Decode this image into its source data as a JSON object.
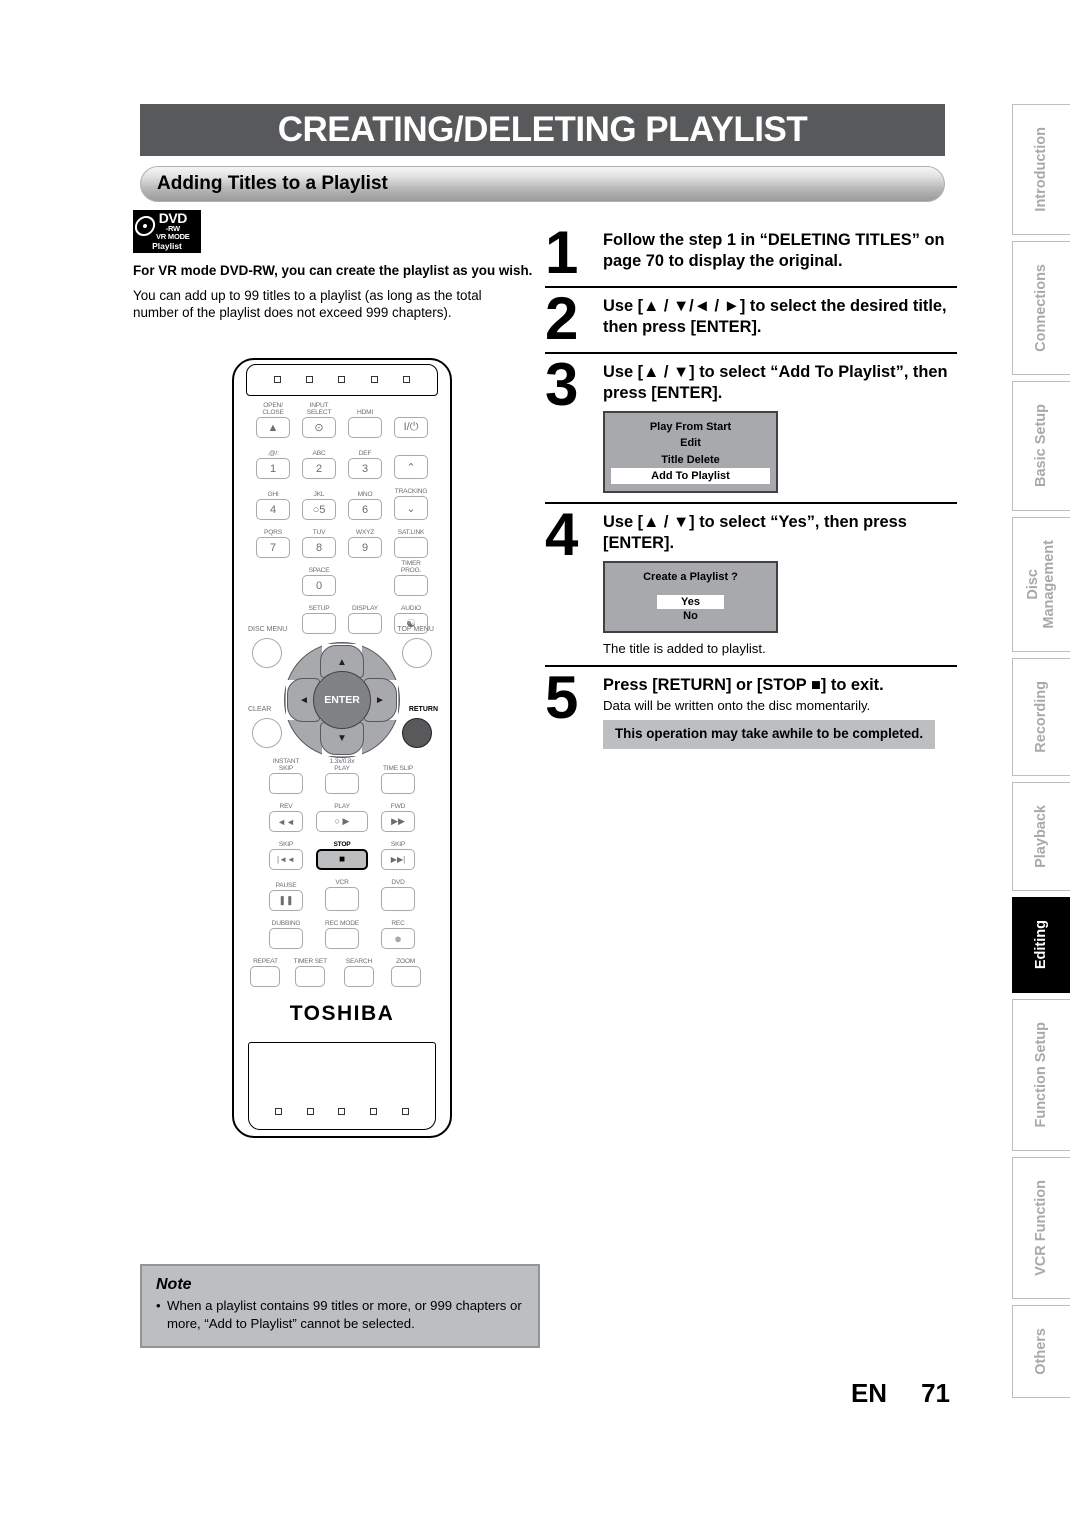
{
  "header": {
    "title": "CREATING/DELETING PLAYLIST",
    "subtitle": "Adding Titles to a Playlist"
  },
  "disc_badge": {
    "brand": "DVD",
    "format": "-RW",
    "mode": "VR MODE",
    "caption": "Playlist"
  },
  "intro": {
    "bold": "For VR mode DVD-RW, you can create the playlist as you wish.",
    "normal": "You can add up to 99 titles to a playlist (as long as the total number of the playlist does not exceed 999 chapters)."
  },
  "steps": [
    {
      "number": "1",
      "title": "Follow the step 1 in “DELETING TITLES” on page 70 to display the original."
    },
    {
      "number": "2",
      "title": "Use [▲ / ▼/◄ / ►] to select the desired title, then press [ENTER]."
    },
    {
      "number": "3",
      "title": "Use [▲ / ▼] to select “Add To Playlist”, then press [ENTER].",
      "osd_menu": {
        "items": [
          "Play From Start",
          "Edit",
          "Title Delete",
          "Add To Playlist"
        ],
        "selected": "Add To Playlist"
      }
    },
    {
      "number": "4",
      "title": "Use [▲ / ▼] to select “Yes”, then press [ENTER].",
      "osd_dialog": {
        "question": "Create a Playlist ?",
        "options": [
          "Yes",
          "No"
        ],
        "selected": "Yes"
      },
      "after_text": "The title is added to playlist."
    },
    {
      "number": "5",
      "title": "Press [RETURN] or [STOP ■] to exit.",
      "subtitle": "Data will be written onto the disc momentarily.",
      "highlight": "This operation may take awhile to be completed."
    }
  ],
  "note": {
    "title": "Note",
    "items": [
      "When a playlist contains 99 titles or more, or 999 chapters or more, “Add to Playlist” cannot be selected."
    ]
  },
  "footer": {
    "language": "EN",
    "page": "71"
  },
  "side_tabs": [
    {
      "label": "Introduction",
      "active": false
    },
    {
      "label": "Connections",
      "active": false
    },
    {
      "label": "Basic Setup",
      "active": false
    },
    {
      "label": "Disc\nManagement",
      "active": false
    },
    {
      "label": "Recording",
      "active": false
    },
    {
      "label": "Playback",
      "active": false
    },
    {
      "label": "Editing",
      "active": true
    },
    {
      "label": "Function Setup",
      "active": false
    },
    {
      "label": "VCR Function",
      "active": false
    },
    {
      "label": "Others",
      "active": false
    }
  ],
  "remote": {
    "brand": "TOSHIBA",
    "rows": [
      [
        {
          "label": "OPEN/\nCLOSE",
          "glyph": "▲",
          "shape": "rect"
        },
        {
          "label": "INPUT\nSELECT",
          "glyph": "⊙",
          "shape": "rect"
        },
        {
          "label": "HDMI",
          "glyph": "",
          "shape": "rect"
        },
        {
          "label": "",
          "glyph": "I/⏻",
          "shape": "rect"
        }
      ],
      [
        {
          "label": ".@/:",
          "glyph": "1",
          "shape": "rect"
        },
        {
          "label": "ABC",
          "glyph": "2",
          "shape": "rect"
        },
        {
          "label": "DEF",
          "glyph": "3",
          "shape": "rect"
        },
        {
          "label": "",
          "glyph": "⌃",
          "shape": "rect"
        }
      ],
      [
        {
          "label": "GHI",
          "glyph": "4",
          "shape": "rect"
        },
        {
          "label": "JKL",
          "glyph": "○5",
          "shape": "rect"
        },
        {
          "label": "MNO",
          "glyph": "6",
          "shape": "rect"
        },
        {
          "label": "TRACKING",
          "glyph": "⌄",
          "shape": "rect"
        }
      ],
      [
        {
          "label": "PQRS",
          "glyph": "7",
          "shape": "rect"
        },
        {
          "label": "TUV",
          "glyph": "8",
          "shape": "rect"
        },
        {
          "label": "WXYZ",
          "glyph": "9",
          "shape": "rect"
        },
        {
          "label": "SAT.LINK",
          "glyph": "",
          "shape": "rect"
        }
      ],
      [
        {
          "label": "",
          "glyph": "",
          "shape": "none"
        },
        {
          "label": "SPACE",
          "glyph": "0",
          "shape": "rect"
        },
        {
          "label": "",
          "glyph": "",
          "shape": "none"
        },
        {
          "label": "TIMER\nPROG.",
          "glyph": "",
          "shape": "rect"
        }
      ],
      [
        {
          "label": "",
          "glyph": "",
          "shape": "none"
        },
        {
          "label": "SETUP",
          "glyph": "",
          "shape": "rect"
        },
        {
          "label": "DISPLAY",
          "glyph": "",
          "shape": "rect"
        },
        {
          "label": "AUDIO",
          "glyph": "☯",
          "shape": "rect"
        }
      ]
    ],
    "nav": {
      "up": "▲",
      "down": "▼",
      "left": "◄",
      "right": "►",
      "enter": "ENTER",
      "disc_menu": "DISC MENU",
      "top_menu": "TOP MENU",
      "clear": "CLEAR",
      "return": "RETURN"
    },
    "transport_rows": [
      [
        {
          "label": "INSTANT\nSKIP",
          "glyph": ""
        },
        {
          "label": "1.3x/0.8x\nPLAY",
          "glyph": ""
        },
        {
          "label": "TIME SLIP",
          "glyph": ""
        }
      ],
      [
        {
          "label": "REV",
          "glyph": "◄◄"
        },
        {
          "label": "PLAY",
          "glyph": "○  ▶"
        },
        {
          "label": "FWD",
          "glyph": "▶▶"
        }
      ],
      [
        {
          "label": "SKIP",
          "glyph": "|◄◄"
        },
        {
          "label": "STOP",
          "glyph": "■"
        },
        {
          "label": "SKIP",
          "glyph": "▶▶|"
        }
      ],
      [
        {
          "label": "PAUSE",
          "glyph": "❚❚"
        },
        {
          "label": "VCR",
          "glyph": ""
        },
        {
          "label": "DVD",
          "glyph": ""
        }
      ],
      [
        {
          "label": "DUBBING",
          "glyph": ""
        },
        {
          "label": "REC MODE",
          "glyph": ""
        },
        {
          "label": "REC",
          "glyph": "●"
        }
      ],
      [
        {
          "label": "REPEAT",
          "glyph": ""
        },
        {
          "label": "TIMER SET",
          "glyph": ""
        },
        {
          "label": "SEARCH",
          "glyph": ""
        },
        {
          "label": "ZOOM",
          "glyph": ""
        }
      ]
    ]
  }
}
